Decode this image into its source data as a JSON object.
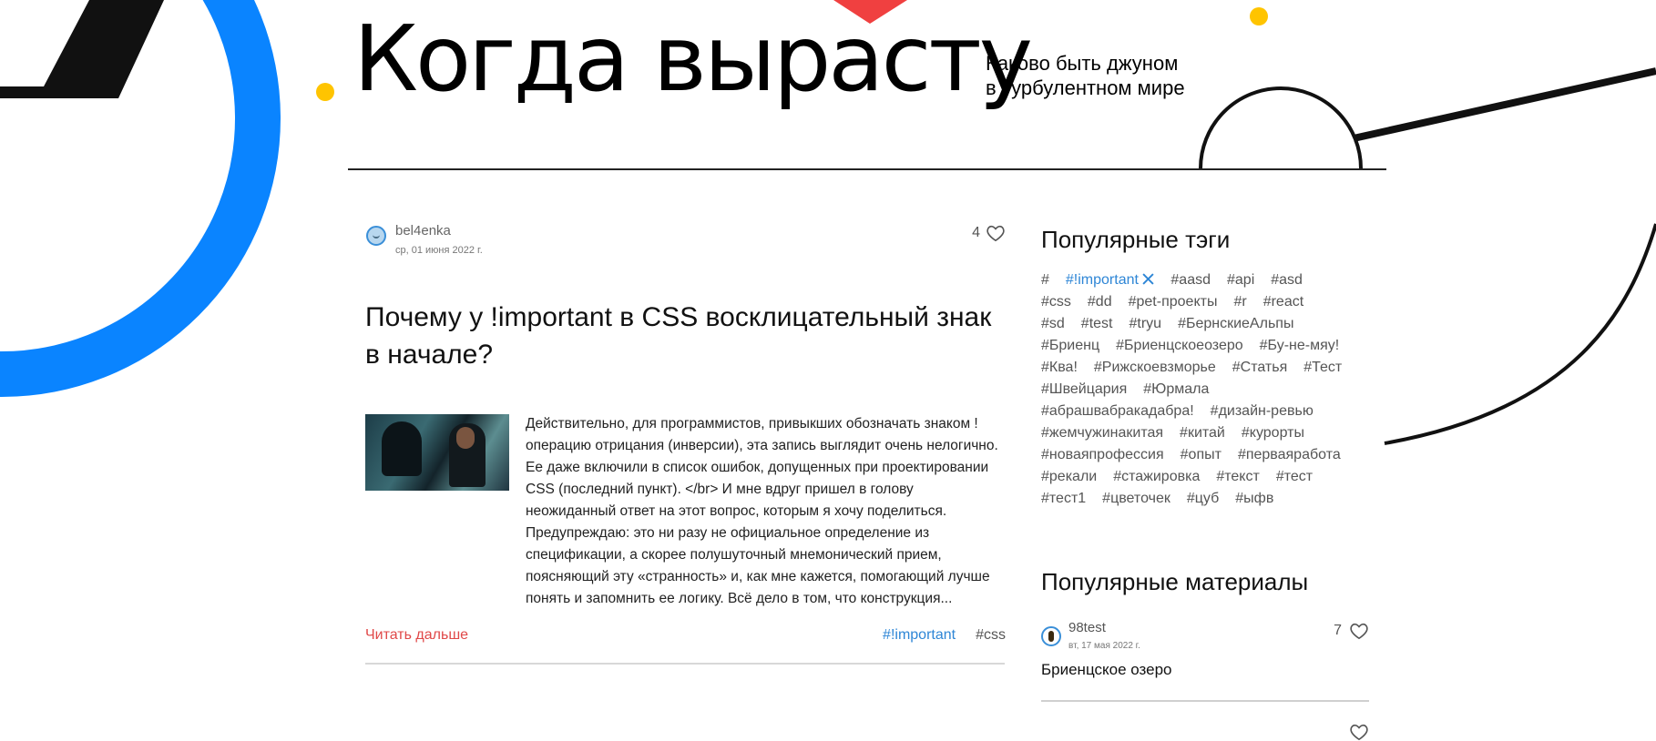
{
  "site": {
    "title": "Когда вырасту",
    "tagline_line1": "Каково быть джуном",
    "tagline_line2": "в турбулентном мире"
  },
  "colors": {
    "accent_blue": "#0a84ff",
    "accent_red": "#f04040",
    "accent_yellow": "#ffc400",
    "link_blue": "#2e86d6",
    "read_more_red": "#e04848"
  },
  "post": {
    "author": "bel4enka",
    "date": "ср, 01 июня 2022 г.",
    "likes": "4",
    "title": "Почему у !important в CSS восклицательный знак в начале?",
    "excerpt": "Действительно, для программистов, привыкших обозначать знаком ! операцию отрицания (инверсии), эта запись выглядит очень нелогично. Ее даже включили в список ошибок, допущенных при проектировании CSS (последний пункт). </br> И мне вдруг пришел в голову неожиданный ответ на этот вопрос, которым я хочу поделиться. Предупреждаю: это ни разу не официальное определение из спецификации, а скорее полушуточный мнемонический прием, поясняющий эту «странность» и, как мне кажется, помогающий лучше понять и запомнить ее логику. Всё дело в том, что конструкция...",
    "read_more": "Читать дальше",
    "tags": [
      "#!important",
      "#css"
    ]
  },
  "sidebar": {
    "popular_tags_heading": "Популярные тэги",
    "tags": [
      "#",
      "#!important",
      "#aasd",
      "#api",
      "#asd",
      "#css",
      "#dd",
      "#pet-проекты",
      "#r",
      "#react",
      "#sd",
      "#test",
      "#tryu",
      "#БернскиеАльпы",
      "#Бриенц",
      "#Бриенцскоеозеро",
      "#Бу-не-мяу!",
      "#Ква!",
      "#Рижскоевзморье",
      "#Статья",
      "#Тест",
      "#Швейцария",
      "#Юрмала",
      "#абрашвабракадабра!",
      "#дизайн-ревью",
      "#жемчужинакитая",
      "#китай",
      "#курорты",
      "#новаяпрофессия",
      "#опыт",
      "#перваяработа",
      "#рекали",
      "#стажировка",
      "#текст",
      "#тест",
      "#тест1",
      "#цветочек",
      "#цуб",
      "#ыфв"
    ],
    "active_tag_remove_icon": "close-icon",
    "popular_posts_heading": "Популярные материалы",
    "popular_posts": [
      {
        "author": "98test",
        "date": "вт, 17 мая 2022 г.",
        "likes": "7",
        "title": "Бриенцское озеро"
      }
    ]
  }
}
